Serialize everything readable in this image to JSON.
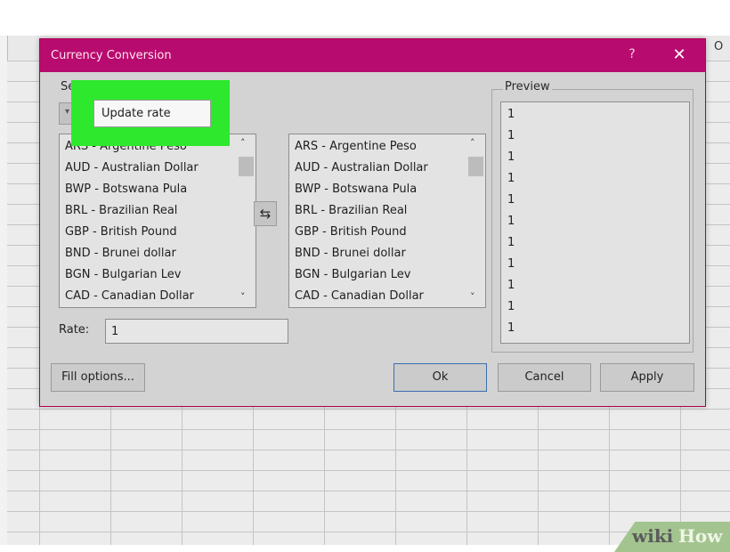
{
  "spreadsheet": {
    "visible_column_letter": "O"
  },
  "dialog": {
    "title": "Currency Conversion",
    "help_glyph": "?",
    "close_glyph": "✕",
    "source_section_label": "Se",
    "dropdown_arrow": "▾",
    "update_rate_label": "Update rate",
    "from_list": [
      "ARS - Argentine Peso",
      "AUD - Australian Dollar",
      "BWP - Botswana Pula",
      "BRL - Brazilian Real",
      "GBP - British Pound",
      "BND - Brunei dollar",
      "BGN - Bulgarian Lev",
      "CAD - Canadian Dollar"
    ],
    "to_list": [
      "ARS - Argentine Peso",
      "AUD - Australian Dollar",
      "BWP - Botswana Pula",
      "BRL - Brazilian Real",
      "GBP - British Pound",
      "BND - Brunei dollar",
      "BGN - Bulgarian Lev",
      "CAD - Canadian Dollar"
    ],
    "scroll_up_glyph": "˄",
    "scroll_down_glyph": "˅",
    "swap_glyph": "⇆",
    "rate_label": "Rate:",
    "rate_value": "1",
    "preview_label": "Preview",
    "preview_values": [
      "1",
      "1",
      "1",
      "1",
      "1",
      "1",
      "1",
      "1",
      "1",
      "1",
      "1"
    ],
    "buttons": {
      "fill_options": "Fill options...",
      "ok": "Ok",
      "cancel": "Cancel",
      "apply": "Apply"
    }
  },
  "colors": {
    "titlebar": "#b80b6f",
    "highlight": "#2ee82e",
    "dialog_bg": "#d3d3d3"
  },
  "watermark": {
    "wiki": "wiki",
    "how": "How"
  }
}
